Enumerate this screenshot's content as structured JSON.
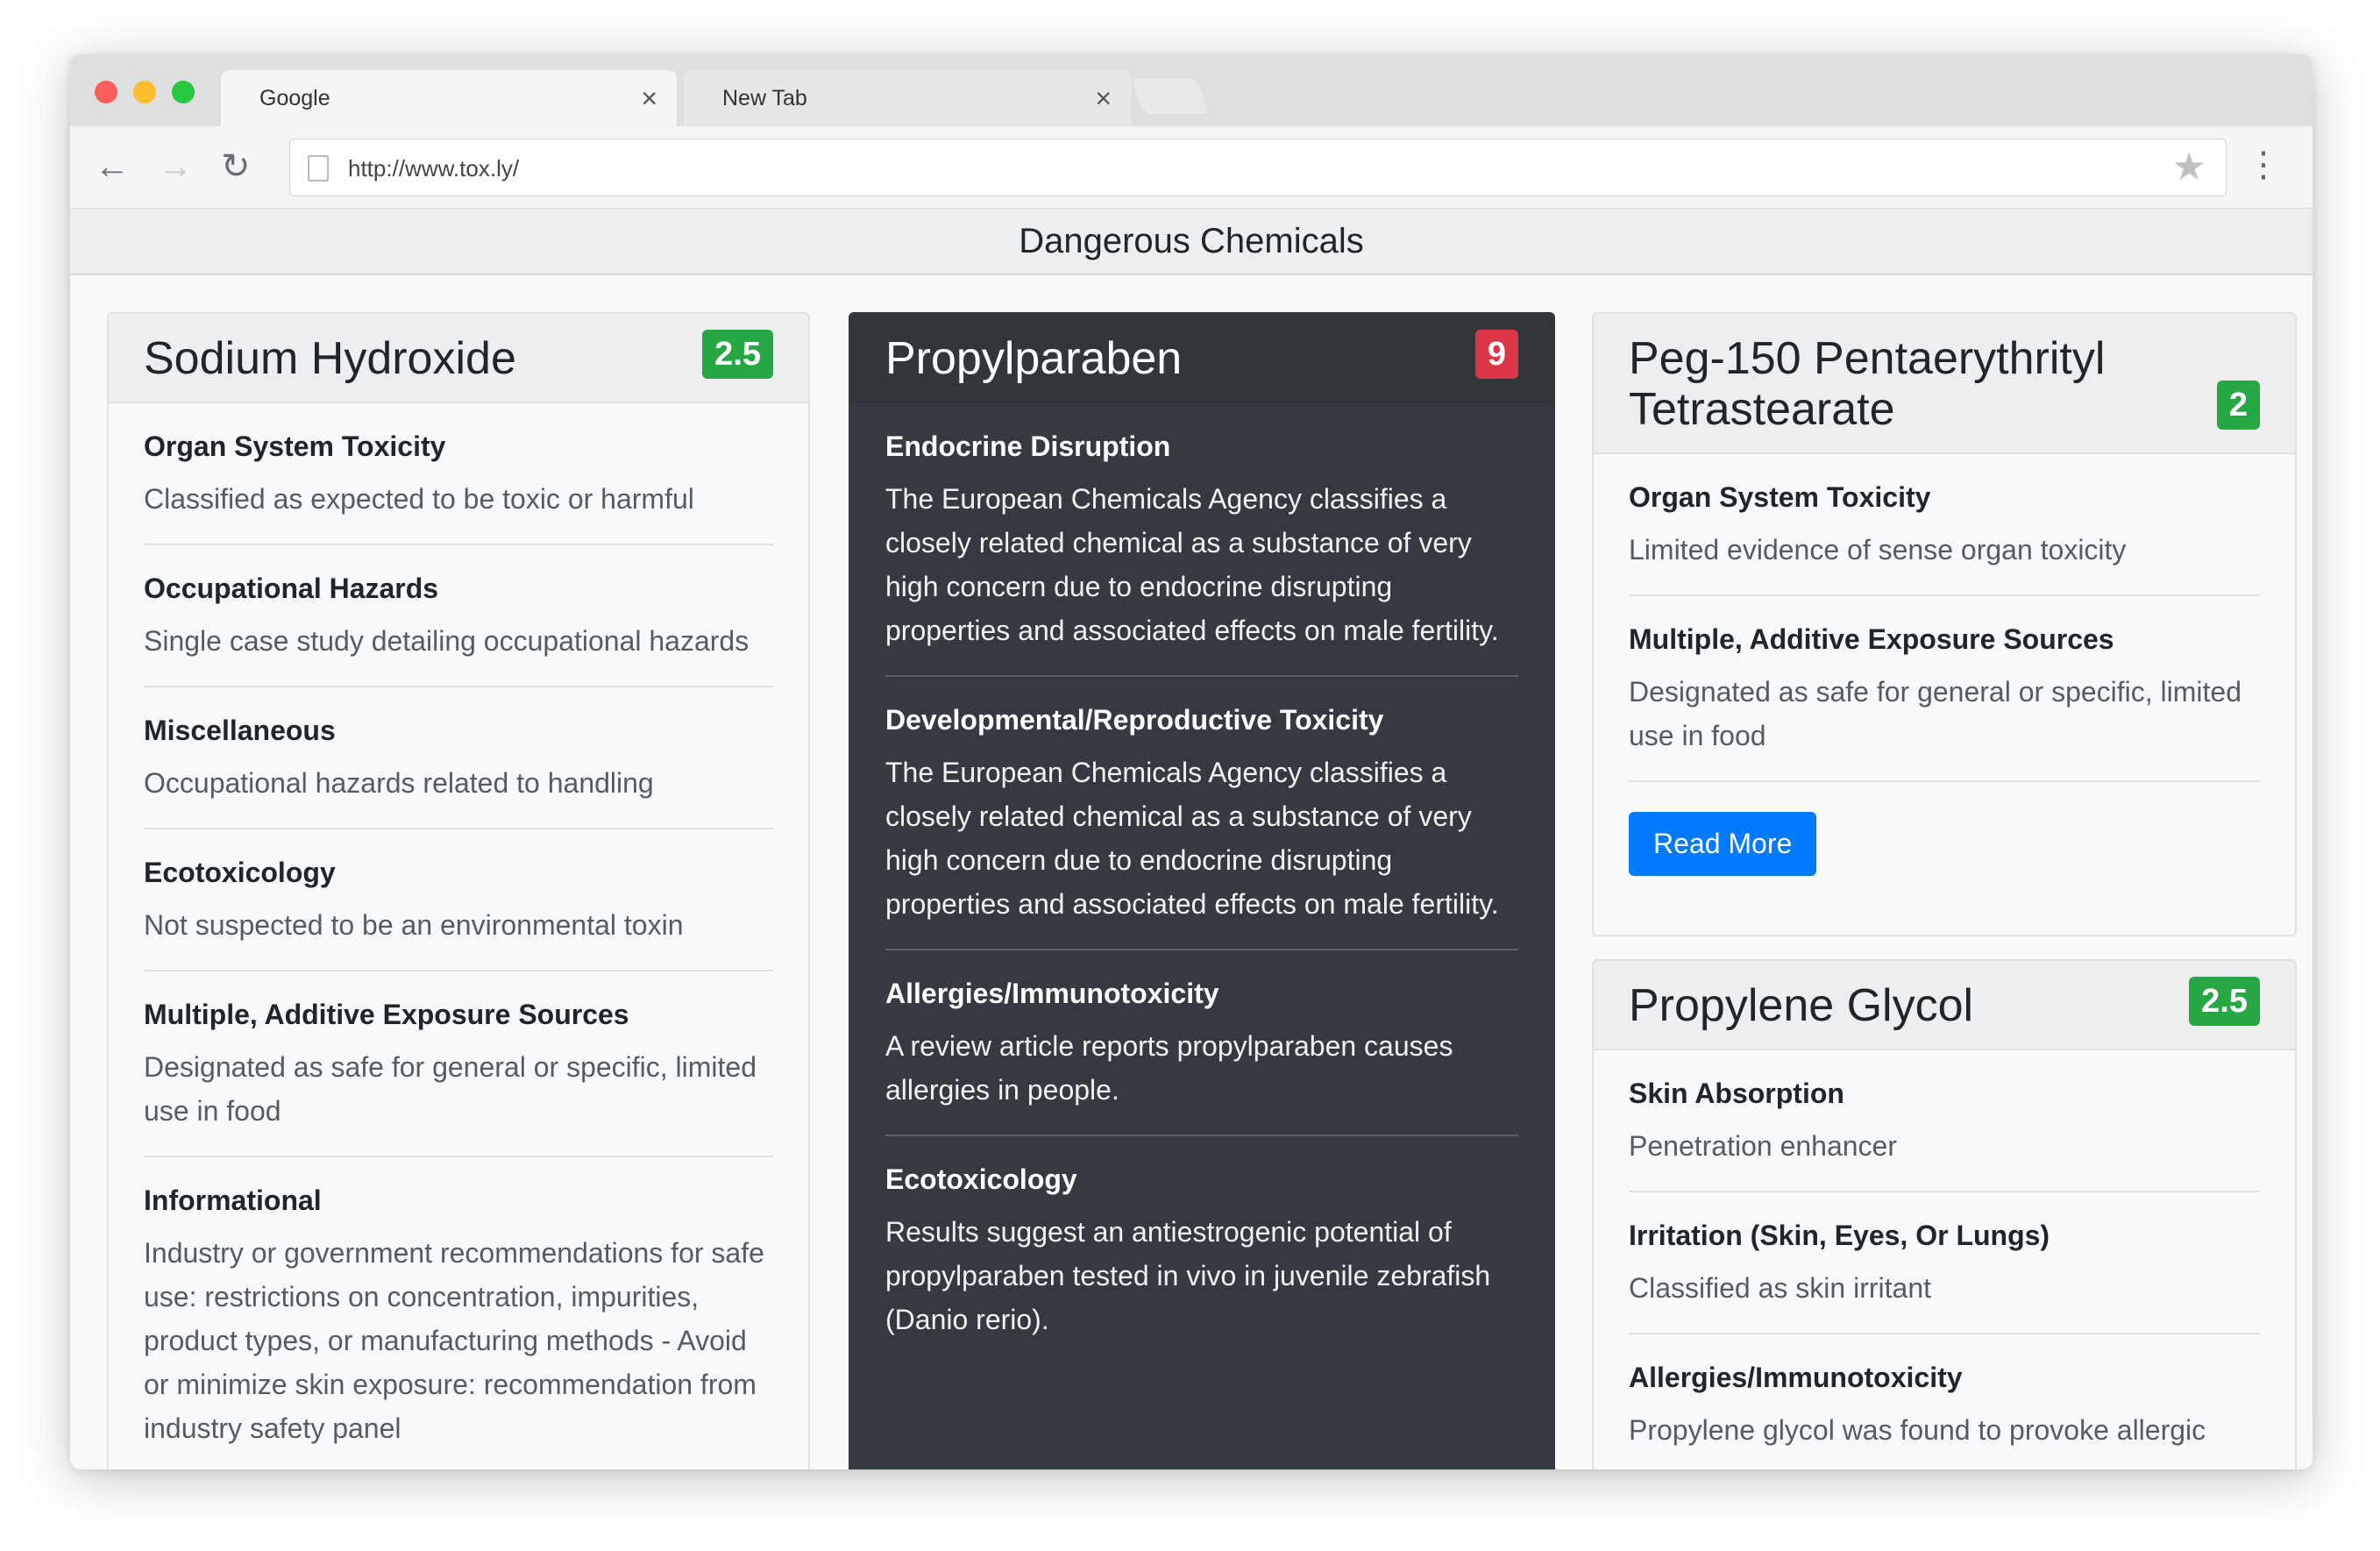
{
  "browser": {
    "tabs": [
      {
        "label": "Google",
        "active": true
      },
      {
        "label": "New Tab",
        "active": false
      }
    ],
    "url": "http://www.tox.ly/"
  },
  "page": {
    "title": "Dangerous Chemicals"
  },
  "cards": [
    {
      "name": "Sodium Hydroxide",
      "score": "2.5",
      "score_color": "#28a745",
      "items": [
        {
          "title": "Organ System Toxicity",
          "desc": "Classified as expected to be toxic or harmful"
        },
        {
          "title": "Occupational Hazards",
          "desc": "Single case study detailing occupational hazards"
        },
        {
          "title": "Miscellaneous",
          "desc": "Occupational hazards related to handling"
        },
        {
          "title": "Ecotoxicology",
          "desc": "Not suspected to be an environmental toxin"
        },
        {
          "title": "Multiple, Additive Exposure Sources",
          "desc": "Designated as safe for general or specific, limited use in food"
        },
        {
          "title": "Informational",
          "desc": "Industry or government recommendations for safe use: restrictions on concentration, impurities, product types, or manufacturing methods - Avoid or minimize skin exposure: recommendation from industry safety panel"
        }
      ]
    },
    {
      "name": "Propylparaben",
      "score": "9",
      "score_color": "#dc3545",
      "items": [
        {
          "title": "Endocrine Disruption",
          "desc": "The European Chemicals Agency classifies a closely related chemical as a substance of very high concern due to endocrine disrupting properties and associated effects on male fertility."
        },
        {
          "title": "Developmental/Reproductive Toxicity",
          "desc": "The European Chemicals Agency classifies a closely related chemical as a substance of very high concern due to endocrine disrupting properties and associated effects on male fertility."
        },
        {
          "title": "Allergies/Immunotoxicity",
          "desc": "A review article reports propylparaben causes allergies in people."
        },
        {
          "title": "Ecotoxicology",
          "desc": "Results suggest an antiestrogenic potential of propylparaben tested in vivo in juvenile zebrafish (Danio rerio)."
        }
      ]
    },
    {
      "name": "Peg-150 Pentaerythrityl Tetrastearate",
      "score": "2",
      "score_color": "#28a745",
      "items": [
        {
          "title": "Organ System Toxicity",
          "desc": "Limited evidence of sense organ toxicity"
        },
        {
          "title": "Multiple, Additive Exposure Sources",
          "desc": "Designated as safe for general or specific, limited use in food"
        }
      ],
      "button_label": "Read More"
    },
    {
      "name": "Propylene Glycol",
      "score": "2.5",
      "score_color": "#28a745",
      "items": [
        {
          "title": "Skin Absorption",
          "desc": "Penetration enhancer"
        },
        {
          "title": "Irritation (Skin, Eyes, Or Lungs)",
          "desc": "Classified as skin irritant"
        },
        {
          "title": "Allergies/Immunotoxicity",
          "desc": "Propylene glycol was found to provoke allergic"
        }
      ]
    }
  ]
}
